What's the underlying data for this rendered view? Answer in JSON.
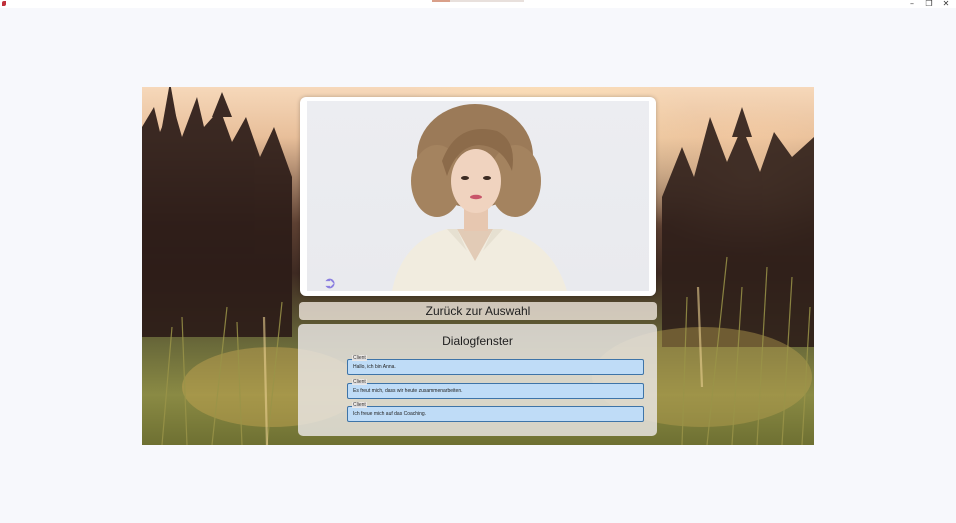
{
  "window": {
    "minimize_glyph": "–",
    "maximize_glyph": "❐",
    "close_glyph": "✕"
  },
  "video": {
    "watermark_icon": "play-logo-icon",
    "watermark_glyph": "➲"
  },
  "navigation": {
    "back_label": "Zurück zur Auswahl"
  },
  "dialog": {
    "title": "Dialogfenster",
    "messages": [
      {
        "speaker": "Client",
        "text": "Hallo, ich bin Anna."
      },
      {
        "speaker": "Client",
        "text": "Es freut mich, dass wir heute zusammenarbeiten."
      },
      {
        "speaker": "Client",
        "text": "Ich freue mich auf das Coaching."
      }
    ]
  },
  "colors": {
    "message_fill": "#bfdcf7",
    "message_border": "#3e74a8",
    "page_background": "#f7f8fc"
  }
}
